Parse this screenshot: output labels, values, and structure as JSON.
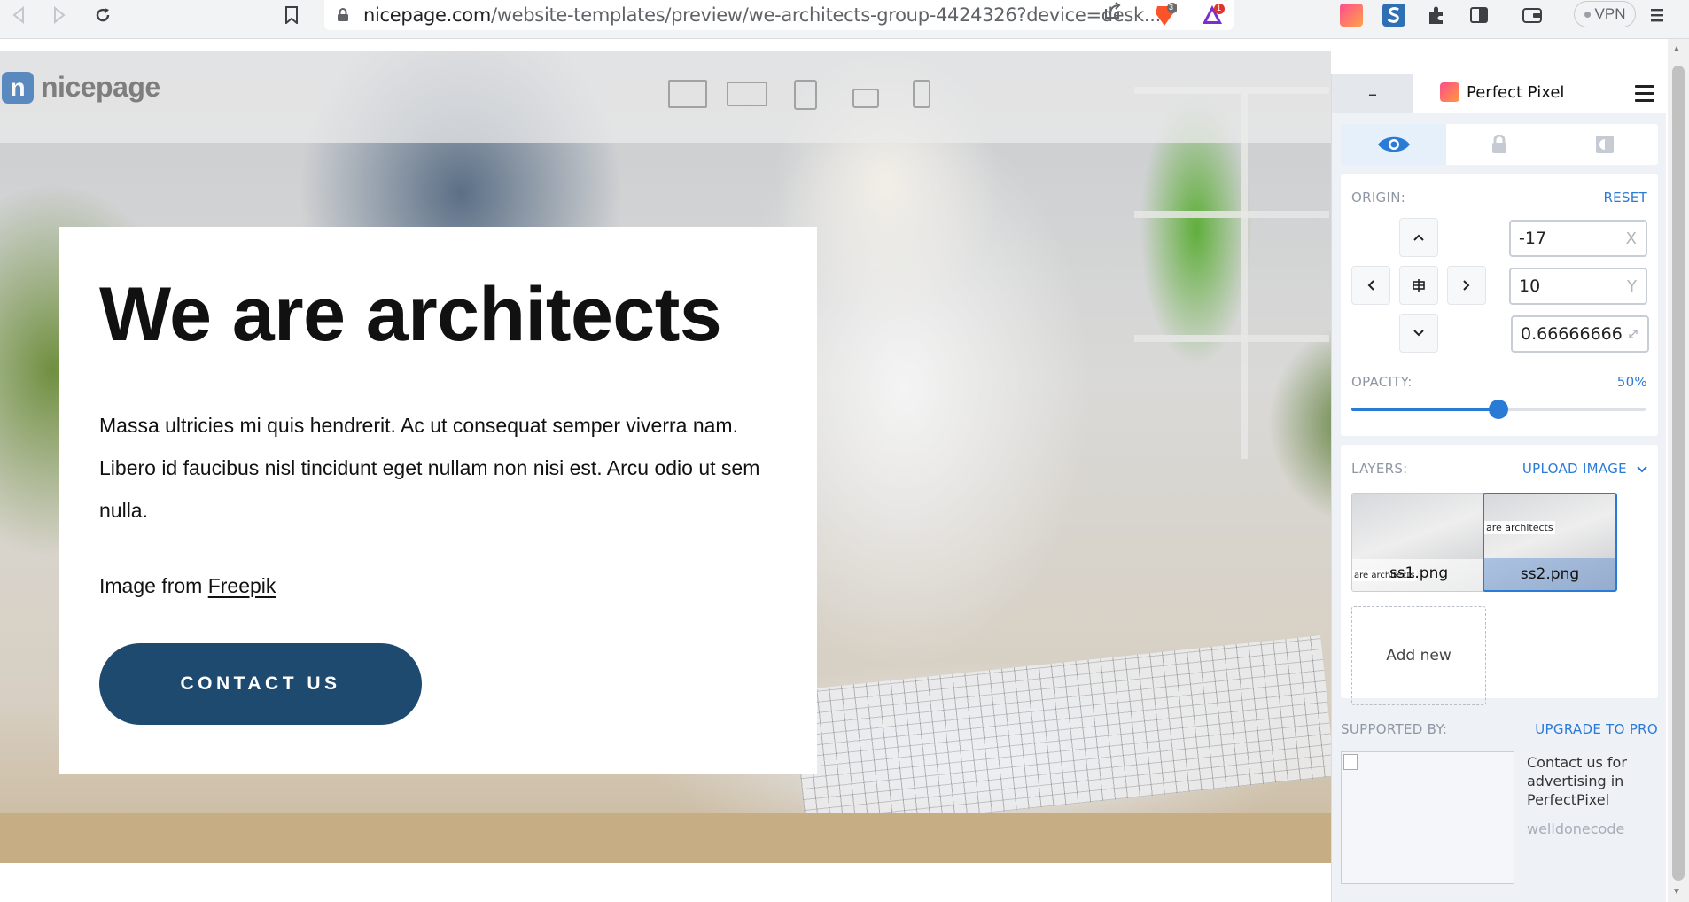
{
  "browser": {
    "url_host": "nicepage.com",
    "url_path": "/website-templates/preview/we-architects-group-4424326?device=desk...",
    "brave_shield_count": "3",
    "brave_rewards_count": "1",
    "vpn_label": "VPN"
  },
  "site": {
    "logo_text": "nicepage",
    "hero": {
      "title": "We are architects",
      "body": "Massa ultricies mi quis hendrerit. Ac ut consequat semper viverra nam. Libero id faucibus nisl tincidunt eget nullam non nisi est. Arcu odio ut sem nulla.",
      "credit_prefix": "Image from ",
      "credit_link": "Freepik",
      "button_label": "CONTACT US"
    },
    "colors": {
      "button_bg": "#1f4a70"
    }
  },
  "perfect_pixel": {
    "minimize_label": "–",
    "title": "Perfect Pixel",
    "tabs": [
      {
        "icon": "eye-icon",
        "active": true
      },
      {
        "icon": "lock-icon",
        "active": false
      },
      {
        "icon": "invert-icon",
        "active": false
      }
    ],
    "origin": {
      "label": "ORIGIN:",
      "reset_label": "RESET",
      "x_value": "-17",
      "x_suffix": "X",
      "y_value": "10",
      "y_suffix": "Y",
      "scale_value": "0.66666666"
    },
    "opacity": {
      "label": "OPACITY:",
      "value_label": "50%",
      "value": 0.5
    },
    "layers": {
      "label": "LAYERS:",
      "upload_label": "UPLOAD IMAGE",
      "items": [
        {
          "name": "ss1.png",
          "snippet": "are architects",
          "selected": false
        },
        {
          "name": "ss2.png",
          "snippet": "are architects",
          "selected": true
        }
      ],
      "add_new_label": "Add new"
    },
    "supported": {
      "label": "SUPPORTED BY:",
      "upgrade_label": "UPGRADE TO PRO",
      "ad_text": "Contact us for advertising in PerfectPixel",
      "ad_by": "welldonecode"
    },
    "colors": {
      "accent": "#2a7bd6"
    }
  }
}
